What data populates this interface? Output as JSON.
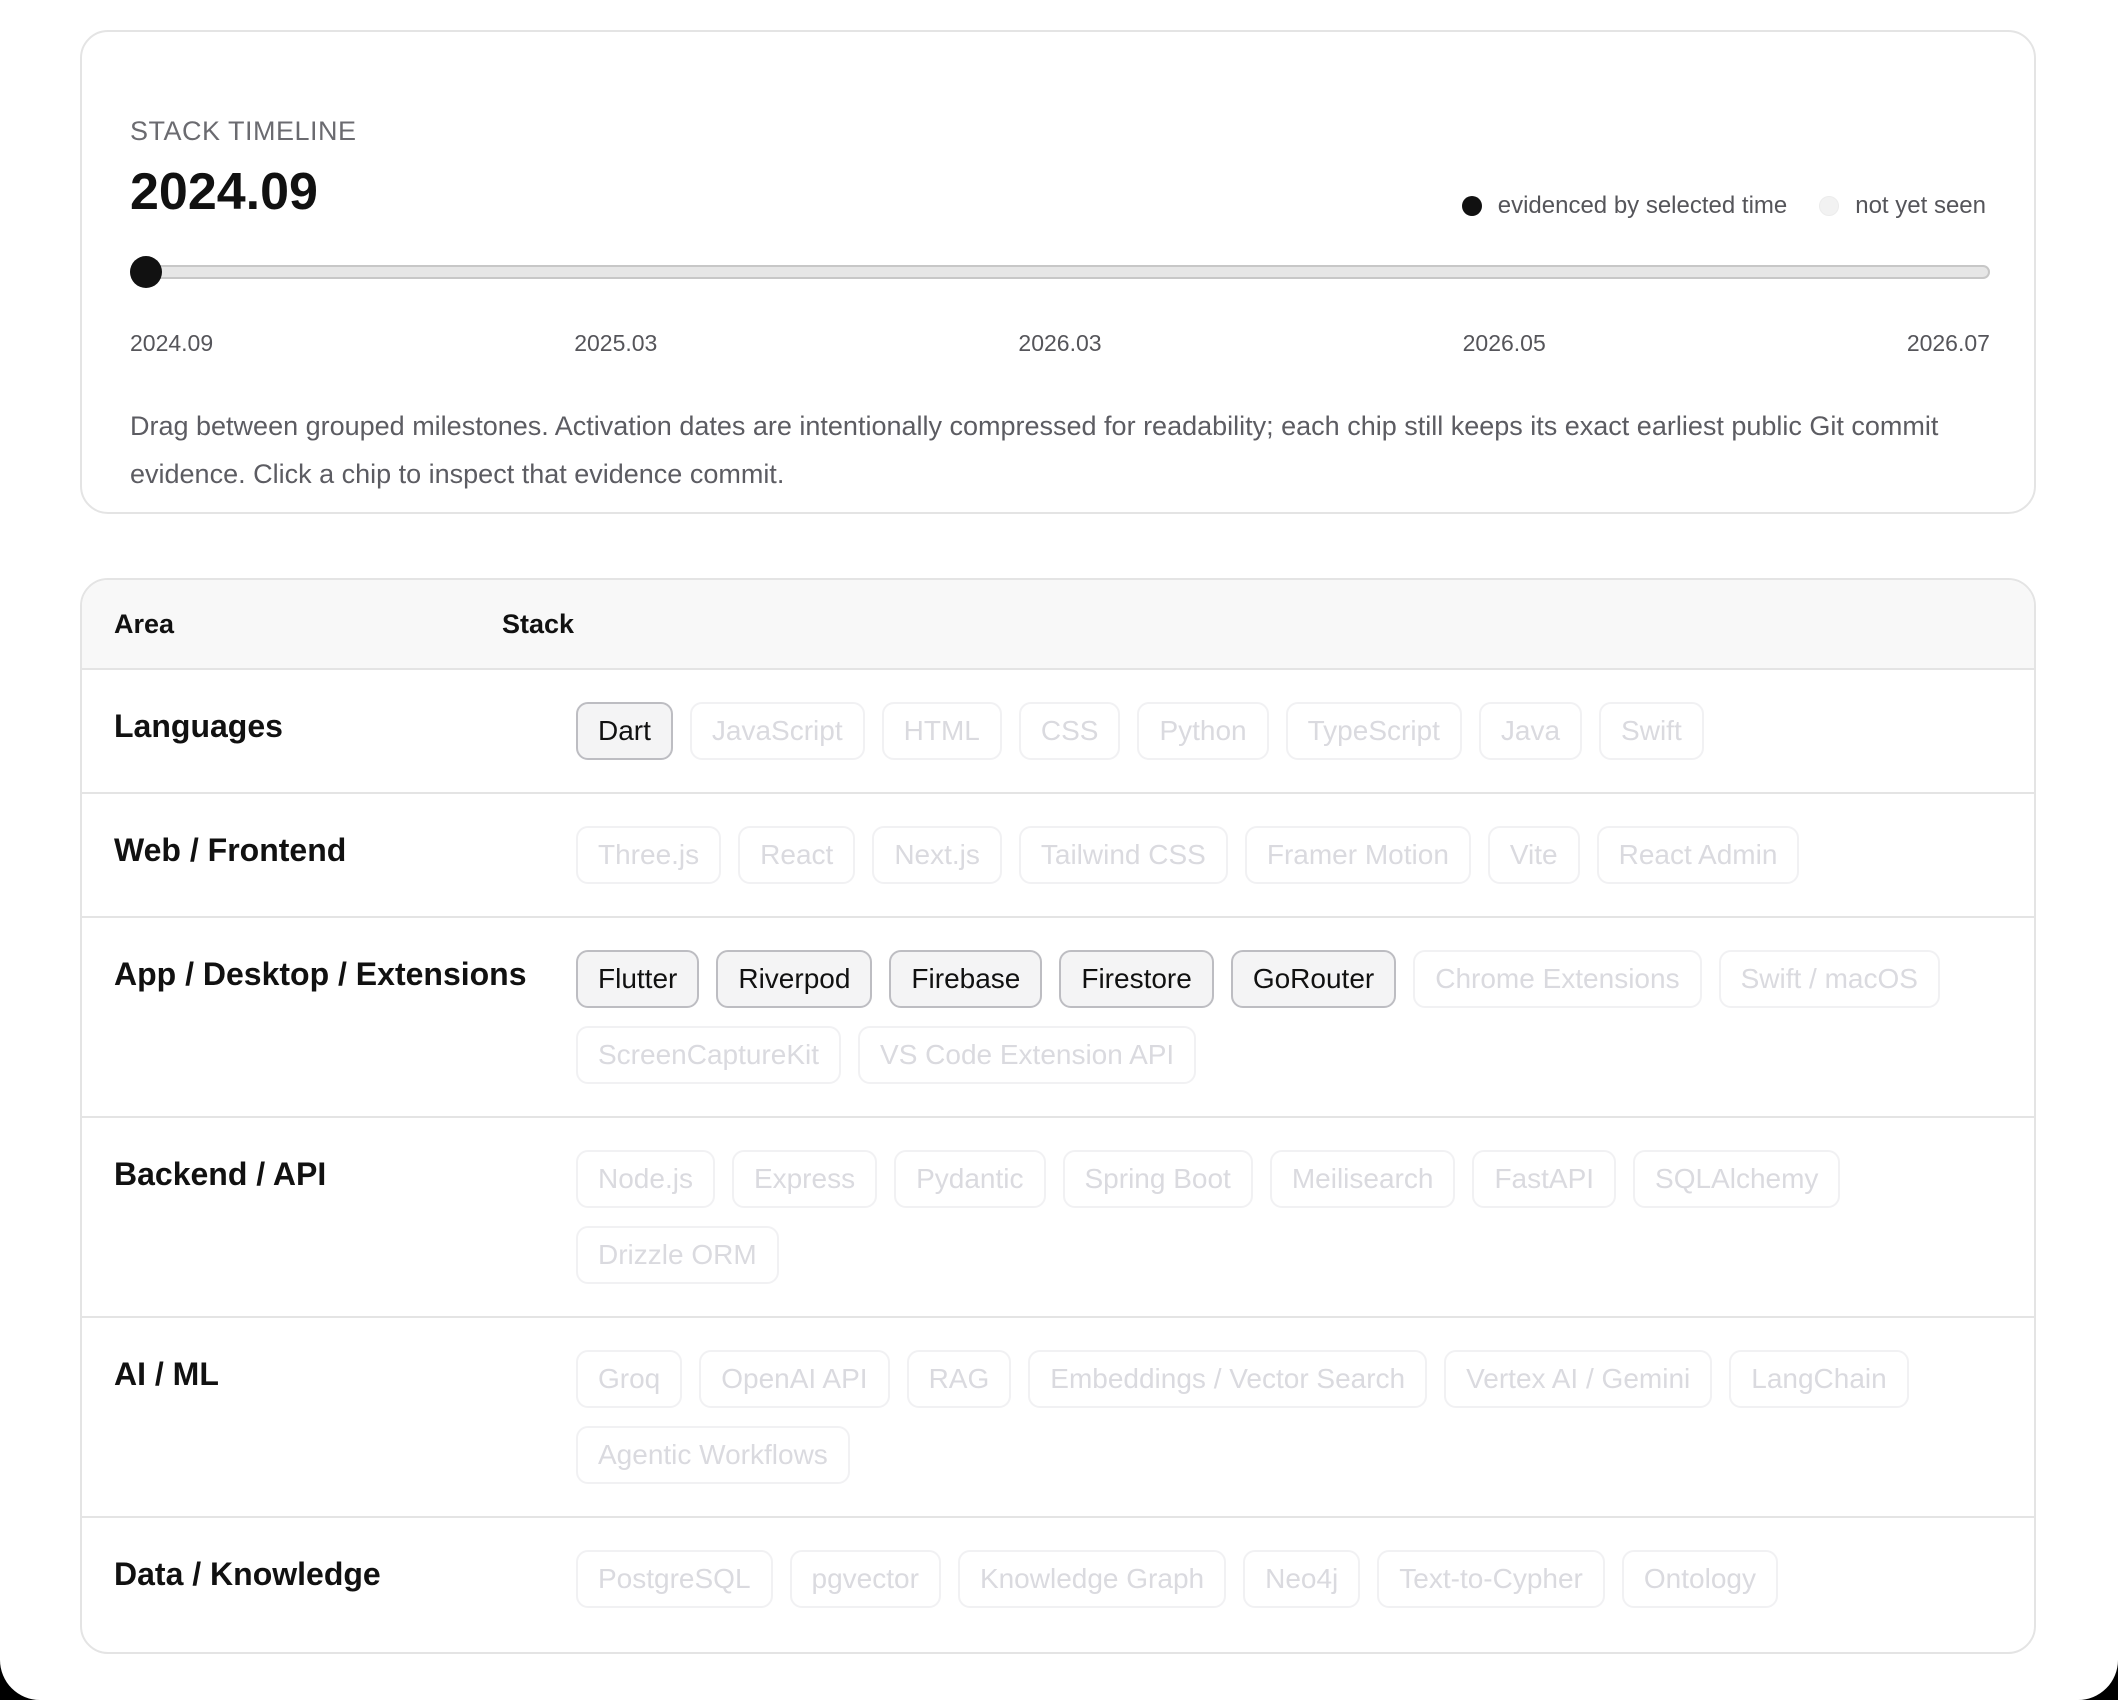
{
  "timeline": {
    "eyebrow": "STACK TIMELINE",
    "selected": "2024.09",
    "legend_on": "evidenced by selected time",
    "legend_off": "not yet seen",
    "position_fraction": 0,
    "ticks": [
      "2024.09",
      "2025.03",
      "2026.03",
      "2026.05",
      "2026.07"
    ],
    "note": "Drag between grouped milestones. Activation dates are intentionally compressed for readability; each chip still keeps its exact earliest public Git commit evidence. Click a chip to inspect that evidence commit."
  },
  "table": {
    "col_area": "Area",
    "col_stack": "Stack",
    "rows": [
      {
        "area": "Languages",
        "chips": [
          {
            "label": "Dart",
            "active": true
          },
          {
            "label": "JavaScript",
            "active": false
          },
          {
            "label": "HTML",
            "active": false
          },
          {
            "label": "CSS",
            "active": false
          },
          {
            "label": "Python",
            "active": false
          },
          {
            "label": "TypeScript",
            "active": false
          },
          {
            "label": "Java",
            "active": false
          },
          {
            "label": "Swift",
            "active": false
          }
        ]
      },
      {
        "area": "Web / Frontend",
        "chips": [
          {
            "label": "Three.js",
            "active": false
          },
          {
            "label": "React",
            "active": false
          },
          {
            "label": "Next.js",
            "active": false
          },
          {
            "label": "Tailwind CSS",
            "active": false
          },
          {
            "label": "Framer Motion",
            "active": false
          },
          {
            "label": "Vite",
            "active": false
          },
          {
            "label": "React Admin",
            "active": false
          }
        ]
      },
      {
        "area": "App / Desktop / Extensions",
        "chips": [
          {
            "label": "Flutter",
            "active": true
          },
          {
            "label": "Riverpod",
            "active": true
          },
          {
            "label": "Firebase",
            "active": true
          },
          {
            "label": "Firestore",
            "active": true
          },
          {
            "label": "GoRouter",
            "active": true
          },
          {
            "label": "Chrome Extensions",
            "active": false
          },
          {
            "label": "Swift / macOS",
            "active": false
          },
          {
            "label": "ScreenCaptureKit",
            "active": false
          },
          {
            "label": "VS Code Extension API",
            "active": false
          }
        ]
      },
      {
        "area": "Backend / API",
        "chips": [
          {
            "label": "Node.js",
            "active": false
          },
          {
            "label": "Express",
            "active": false
          },
          {
            "label": "Pydantic",
            "active": false
          },
          {
            "label": "Spring Boot",
            "active": false
          },
          {
            "label": "Meilisearch",
            "active": false
          },
          {
            "label": "FastAPI",
            "active": false
          },
          {
            "label": "SQLAlchemy",
            "active": false
          },
          {
            "label": "Drizzle ORM",
            "active": false
          }
        ]
      },
      {
        "area": "AI / ML",
        "chips": [
          {
            "label": "Groq",
            "active": false
          },
          {
            "label": "OpenAI API",
            "active": false
          },
          {
            "label": "RAG",
            "active": false
          },
          {
            "label": "Embeddings / Vector Search",
            "active": false
          },
          {
            "label": "Vertex AI / Gemini",
            "active": false
          },
          {
            "label": "LangChain",
            "active": false
          },
          {
            "label": "Agentic Workflows",
            "active": false
          }
        ]
      },
      {
        "area": "Data / Knowledge",
        "chips": [
          {
            "label": "PostgreSQL",
            "active": false
          },
          {
            "label": "pgvector",
            "active": false
          },
          {
            "label": "Knowledge Graph",
            "active": false
          },
          {
            "label": "Neo4j",
            "active": false
          },
          {
            "label": "Text-to-Cypher",
            "active": false
          },
          {
            "label": "Ontology",
            "active": false
          }
        ]
      }
    ]
  }
}
